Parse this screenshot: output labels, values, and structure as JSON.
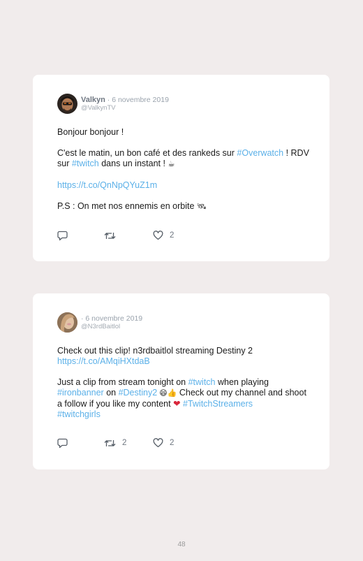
{
  "tweets": [
    {
      "author": "Valkyn",
      "date": " · 6 novembre 2019",
      "handle": "@ValkynTV",
      "line1": "Bonjour bonjour !",
      "p2_a": "C'est le matin, un bon café et des rankeds sur ",
      "p2_tag1": "#Overwatch",
      "p2_b": " ! RDV sur ",
      "p2_tag2": "#twitch",
      "p2_c": " dans un instant ! ",
      "p2_emoji": "☕",
      "link": "https://t.co/QnNpQYuZ1m",
      "p4": "P.S : On met nos ennemis en orbite ",
      "p4_emoji": "🛰",
      "replies": "",
      "retweets": "",
      "likes": "2"
    },
    {
      "author": "",
      "date": " · 6 novembre 2019",
      "handle": "@N3rdBaitlol",
      "p1": "Check out this clip! n3rdbaitlol streaming Destiny 2",
      "link": "https://t.co/AMqiHXtdaB",
      "p2_a": "Just a clip from stream tonight on ",
      "p2_tag1": "#twitch",
      "p2_b": " when playing ",
      "p2_tag2": "#ironbanner",
      "p2_c": " on ",
      "p2_tag3": "#Destiny2",
      "p2_emoji": " 😄👍",
      "p2_d": " Check out my channel and shoot a follow if you like my content ",
      "p2_heart": "❤",
      "p2_tag4": " #TwitchStreamers",
      "p2_tag5": "#twitchgirls",
      "replies": "",
      "retweets": "2",
      "likes": "2"
    }
  ],
  "icons": {
    "reply": "reply-icon",
    "retweet": "retweet-icon",
    "like": "heart-icon"
  },
  "colors": {
    "page_background": "#f1ecec",
    "card": "#ffffff",
    "link": "#5bb0e8",
    "meta": "#9aa3ad",
    "heart_emoji": "#d9263b"
  },
  "page_number": "48"
}
